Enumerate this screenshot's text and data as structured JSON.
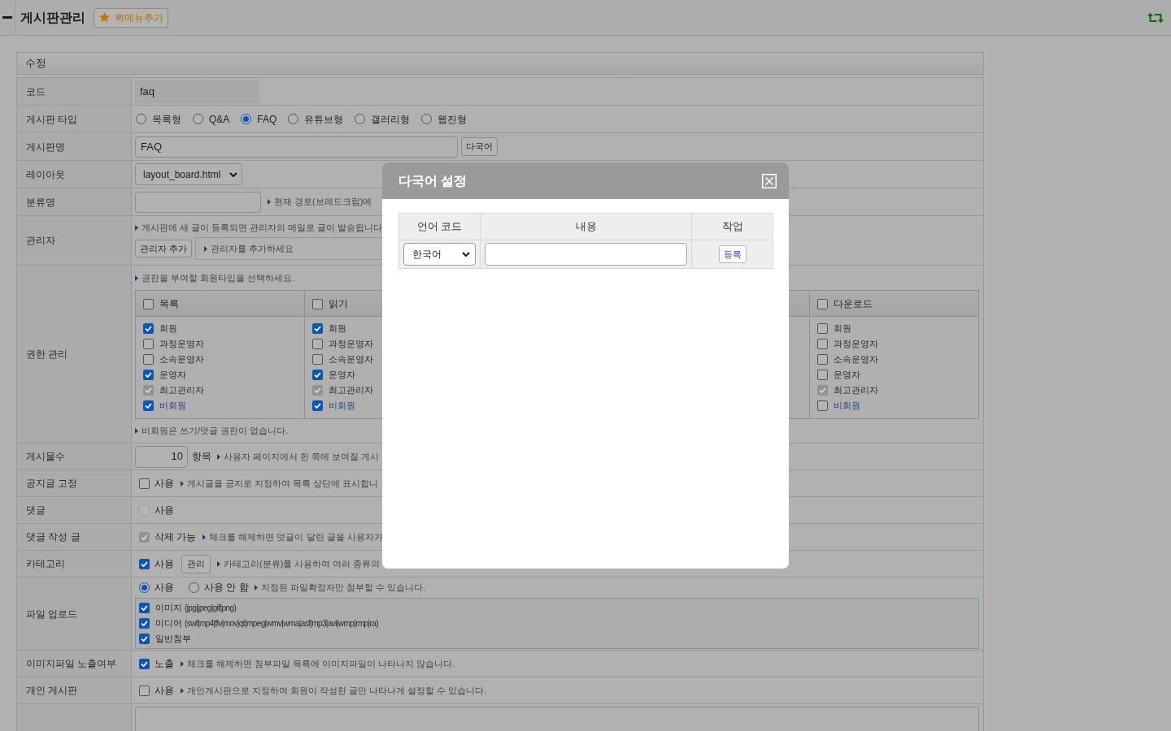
{
  "header": {
    "title": "게시판관리",
    "quick_menu_button": "퀵메뉴추가"
  },
  "form": {
    "title": "수정",
    "rows": [
      {
        "kind": "readonly",
        "label": "코드",
        "value": "faq"
      },
      {
        "kind": "radios",
        "label": "게시판 타입",
        "options": [
          {
            "label": "목록형",
            "selected": false
          },
          {
            "label": "Q&A",
            "selected": false
          },
          {
            "label": "FAQ",
            "selected": true
          },
          {
            "label": "유튜브형",
            "selected": false
          },
          {
            "label": "갤러리형",
            "selected": false
          },
          {
            "label": "웹진형",
            "selected": false
          }
        ]
      },
      {
        "kind": "text_button",
        "label": "게시판명",
        "value": "FAQ",
        "button": "다국어"
      },
      {
        "kind": "select",
        "label": "레이아웃",
        "value": "layout_board.html"
      },
      {
        "kind": "text_note",
        "label": "분류명",
        "note": "현재 경로(브레드크럼)에"
      },
      {
        "kind": "admins",
        "label": "관리자",
        "note": "게시판에 새 글이 등록되면 관리자의 메일로 글이 발송됩니다",
        "button": "관리자 추가",
        "list_hint": "관리자를 추가하세요"
      },
      {
        "kind": "permissions",
        "label": "권한 관리",
        "note": "권한을 부여할 회원타입을 선택하세요.",
        "columns": [
          {
            "title": "목록",
            "checked": false,
            "roles": [
              {
                "kind": "member",
                "label": "회원",
                "checked": true,
                "disabled": false
              },
              {
                "kind": "member",
                "label": "과정운영자",
                "checked": false,
                "disabled": false
              },
              {
                "kind": "member",
                "label": "소속운영자",
                "checked": false,
                "disabled": false
              },
              {
                "kind": "member",
                "label": "운영자",
                "checked": true,
                "disabled": false
              },
              {
                "kind": "member",
                "label": "최고관리자",
                "checked": true,
                "disabled": true
              },
              {
                "kind": "guest",
                "label": "비회원",
                "checked": true,
                "disabled": false
              }
            ]
          },
          {
            "title": "읽기",
            "checked": false,
            "roles": [
              {
                "kind": "member",
                "label": "회원",
                "checked": true,
                "disabled": false
              },
              {
                "kind": "member",
                "label": "과정운영자",
                "checked": false,
                "disabled": false
              },
              {
                "kind": "member",
                "label": "소속운영자",
                "checked": false,
                "disabled": false
              },
              {
                "kind": "member",
                "label": "운영자",
                "checked": true,
                "disabled": false
              },
              {
                "kind": "member",
                "label": "최고관리자",
                "checked": true,
                "disabled": true
              },
              {
                "kind": "guest",
                "label": "비회원",
                "checked": true,
                "disabled": false
              }
            ]
          },
          {
            "title": "다운로드",
            "checked": false,
            "roles": [
              {
                "kind": "member",
                "label": "회원",
                "checked": false,
                "disabled": false
              },
              {
                "kind": "member",
                "label": "과정운영자",
                "checked": false,
                "disabled": false
              },
              {
                "kind": "member",
                "label": "소속운영자",
                "checked": false,
                "disabled": false
              },
              {
                "kind": "member",
                "label": "운영자",
                "checked": false,
                "disabled": false
              },
              {
                "kind": "member",
                "label": "최고관리자",
                "checked": true,
                "disabled": true
              },
              {
                "kind": "guest",
                "label": "비회원",
                "checked": false,
                "disabled": false
              }
            ]
          }
        ],
        "footnote": "비회원은 쓰기/덧글 권한이 없습니다."
      },
      {
        "kind": "count",
        "label": "게시물수",
        "value": "10",
        "unit": "항목",
        "note": "사용자 페이지에서 한 쪽에 보여질 게시"
      },
      {
        "kind": "check_note",
        "label": "공지글 고정",
        "checkbox": {
          "label": "사용",
          "checked": false,
          "disabled": false
        },
        "note": "게시글을 공지로 지정하여 목록 상단에 표시합니"
      },
      {
        "kind": "check_note",
        "label": "댓글",
        "checkbox": {
          "label": "사용",
          "checked": false,
          "disabled": true
        }
      },
      {
        "kind": "check_note",
        "label": "댓글 작성 글",
        "checkbox": {
          "label": "삭제 가능",
          "checked": true,
          "disabled": true
        },
        "note": "체크를 해제하면 덧글이 달린 글을 사용자가"
      },
      {
        "kind": "check_note",
        "label": "카테고리",
        "checkbox": {
          "label": "사용",
          "checked": true,
          "disabled": false
        },
        "button": "관리",
        "note": "카테고리(분류)를 사용하여 여러 종류의"
      },
      {
        "kind": "file_upload",
        "label": "파일 업로드",
        "options": [
          {
            "label": "사용",
            "selected": true
          },
          {
            "label": "사용 안 함",
            "selected": false
          }
        ],
        "note": "지정된 파일확장자만 첨부할 수 있습니다.",
        "types": [
          {
            "label": "이미지",
            "extensions": "(jpg|jpeg|gif|png)",
            "checked": true
          },
          {
            "label": "미디어",
            "extensions": "(swf|mp4|flv|mov|qt|mpeg|wmv|wma|asf|mp3|avi|wmp|rmp|ra)",
            "checked": true
          },
          {
            "label": "일반첨부",
            "checked": true
          }
        ]
      },
      {
        "kind": "check_note",
        "label": "이미지파일 노출여부",
        "checkbox": {
          "label": "노출",
          "checked": true,
          "disabled": false
        },
        "note": "체크를 해제하면 첨부파일 목록에 이미지파일이 나타나지 않습니다."
      },
      {
        "kind": "check_note",
        "label": "개인 게시판",
        "checkbox": {
          "label": "사용",
          "checked": false,
          "disabled": false
        },
        "note": "개인게시판으로 지정하여 회원이 작성한 글만 나타나게 설정할 수 있습니다."
      },
      {
        "kind": "textarea"
      }
    ]
  },
  "modal": {
    "title": "다국어 설정",
    "columns": [
      "언어 코드",
      "내용",
      "작업"
    ],
    "rows": [
      {
        "language": "한국어",
        "button": "등록"
      }
    ]
  }
}
